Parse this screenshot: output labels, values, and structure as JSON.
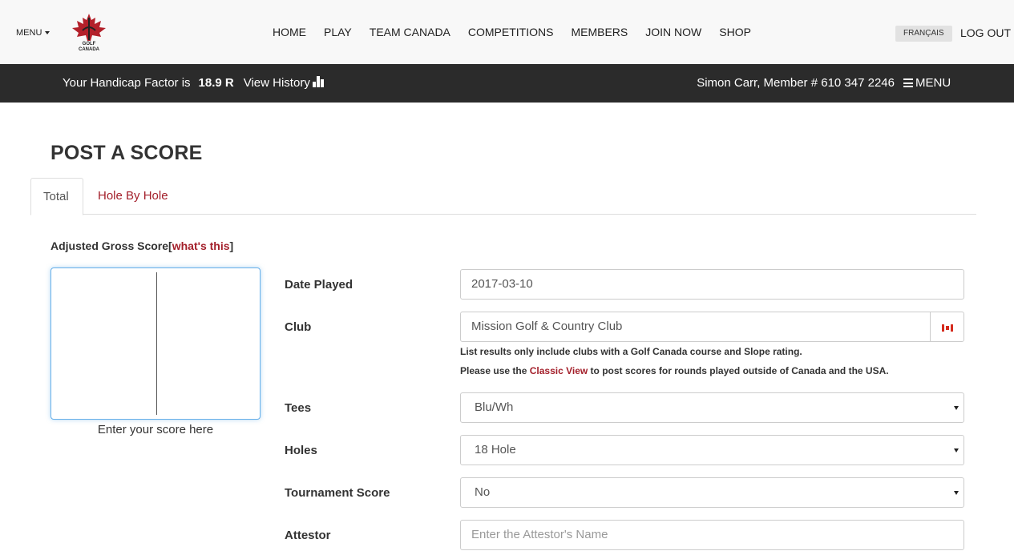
{
  "topbar": {
    "menu_label": "MENU",
    "logo_text_1": "GOLF",
    "logo_text_2": "CANADA",
    "nav": [
      "HOME",
      "PLAY",
      "TEAM CANADA",
      "COMPETITIONS",
      "MEMBERS",
      "JOIN NOW",
      "SHOP"
    ],
    "language": "FRANÇAIS",
    "logout": "LOG OUT"
  },
  "darkbar": {
    "handicap_label": "Your Handicap Factor is",
    "handicap_value": "18.9 R",
    "view_history": "View History",
    "member_info": "Simon Carr, Member # 610 347 2246",
    "menu_label": "MENU",
    "bar_color": "#2b2b2b"
  },
  "page": {
    "title": "POST A SCORE",
    "tabs": [
      "Total",
      "Hole By Hole"
    ],
    "active_tab": "Total",
    "accent_color": "#a31f2a"
  },
  "score": {
    "label": "Adjusted Gross Score",
    "bracket_open": "[",
    "whats_this": "what's this",
    "bracket_close": "]",
    "value": "",
    "hint": "Enter your score here"
  },
  "form": {
    "date_label": "Date Played",
    "date_value": "2017-03-10",
    "club_label": "Club",
    "club_value": "Mission Golf & Country Club",
    "club_flag": "canada-flag-icon",
    "note_1": "List results only include clubs with a Golf Canada course and Slope rating.",
    "note_2_prefix": "Please use the ",
    "note_2_link": "Classic View",
    "note_2_suffix": " to post scores for rounds played outside of Canada and the USA.",
    "tees_label": "Tees",
    "tees_value": "Blu/Wh",
    "holes_label": "Holes",
    "holes_value": "18 Hole",
    "tournament_label": "Tournament Score",
    "tournament_value": "No",
    "attestor_label": "Attestor",
    "attestor_placeholder": "Enter the Attestor's Name"
  }
}
